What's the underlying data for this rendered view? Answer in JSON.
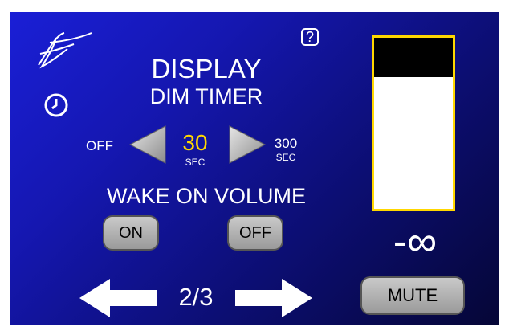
{
  "display": {
    "title": "DISPLAY",
    "subtitle": "DIM TIMER",
    "help_glyph": "?",
    "icons": {
      "help": "help-icon",
      "clock": "clock-icon",
      "logo": "signature-logo"
    }
  },
  "dim_timer": {
    "min_label": "OFF",
    "value": "30",
    "value_unit": "SEC",
    "max_value": "300",
    "max_unit": "SEC"
  },
  "wake_on_volume": {
    "title": "WAKE ON VOLUME",
    "on_label": "ON",
    "off_label": "OFF"
  },
  "pager": {
    "indicator": "2/3"
  },
  "volume": {
    "readout": "-∞",
    "mute_label": "MUTE",
    "level_fraction": 0.0,
    "cap_fraction": 0.23
  },
  "colors": {
    "accent": "#ffd700",
    "background_start": "#1a1fd6",
    "background_end": "#050636",
    "button": "#b4b4b4"
  }
}
